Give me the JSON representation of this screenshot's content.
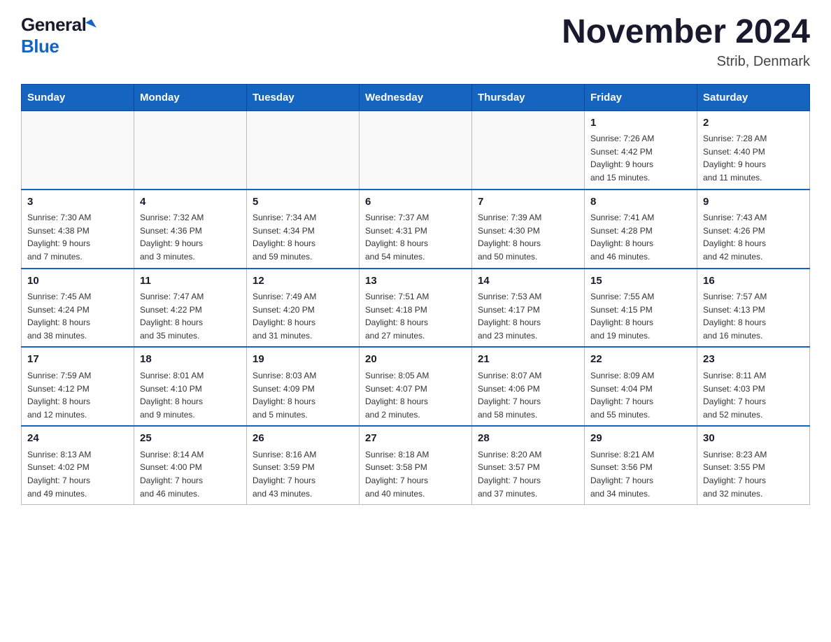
{
  "logo": {
    "general": "General",
    "blue": "Blue"
  },
  "title": "November 2024",
  "location": "Strib, Denmark",
  "days_of_week": [
    "Sunday",
    "Monday",
    "Tuesday",
    "Wednesday",
    "Thursday",
    "Friday",
    "Saturday"
  ],
  "weeks": [
    [
      {
        "day": "",
        "info": ""
      },
      {
        "day": "",
        "info": ""
      },
      {
        "day": "",
        "info": ""
      },
      {
        "day": "",
        "info": ""
      },
      {
        "day": "",
        "info": ""
      },
      {
        "day": "1",
        "info": "Sunrise: 7:26 AM\nSunset: 4:42 PM\nDaylight: 9 hours\nand 15 minutes."
      },
      {
        "day": "2",
        "info": "Sunrise: 7:28 AM\nSunset: 4:40 PM\nDaylight: 9 hours\nand 11 minutes."
      }
    ],
    [
      {
        "day": "3",
        "info": "Sunrise: 7:30 AM\nSunset: 4:38 PM\nDaylight: 9 hours\nand 7 minutes."
      },
      {
        "day": "4",
        "info": "Sunrise: 7:32 AM\nSunset: 4:36 PM\nDaylight: 9 hours\nand 3 minutes."
      },
      {
        "day": "5",
        "info": "Sunrise: 7:34 AM\nSunset: 4:34 PM\nDaylight: 8 hours\nand 59 minutes."
      },
      {
        "day": "6",
        "info": "Sunrise: 7:37 AM\nSunset: 4:31 PM\nDaylight: 8 hours\nand 54 minutes."
      },
      {
        "day": "7",
        "info": "Sunrise: 7:39 AM\nSunset: 4:30 PM\nDaylight: 8 hours\nand 50 minutes."
      },
      {
        "day": "8",
        "info": "Sunrise: 7:41 AM\nSunset: 4:28 PM\nDaylight: 8 hours\nand 46 minutes."
      },
      {
        "day": "9",
        "info": "Sunrise: 7:43 AM\nSunset: 4:26 PM\nDaylight: 8 hours\nand 42 minutes."
      }
    ],
    [
      {
        "day": "10",
        "info": "Sunrise: 7:45 AM\nSunset: 4:24 PM\nDaylight: 8 hours\nand 38 minutes."
      },
      {
        "day": "11",
        "info": "Sunrise: 7:47 AM\nSunset: 4:22 PM\nDaylight: 8 hours\nand 35 minutes."
      },
      {
        "day": "12",
        "info": "Sunrise: 7:49 AM\nSunset: 4:20 PM\nDaylight: 8 hours\nand 31 minutes."
      },
      {
        "day": "13",
        "info": "Sunrise: 7:51 AM\nSunset: 4:18 PM\nDaylight: 8 hours\nand 27 minutes."
      },
      {
        "day": "14",
        "info": "Sunrise: 7:53 AM\nSunset: 4:17 PM\nDaylight: 8 hours\nand 23 minutes."
      },
      {
        "day": "15",
        "info": "Sunrise: 7:55 AM\nSunset: 4:15 PM\nDaylight: 8 hours\nand 19 minutes."
      },
      {
        "day": "16",
        "info": "Sunrise: 7:57 AM\nSunset: 4:13 PM\nDaylight: 8 hours\nand 16 minutes."
      }
    ],
    [
      {
        "day": "17",
        "info": "Sunrise: 7:59 AM\nSunset: 4:12 PM\nDaylight: 8 hours\nand 12 minutes."
      },
      {
        "day": "18",
        "info": "Sunrise: 8:01 AM\nSunset: 4:10 PM\nDaylight: 8 hours\nand 9 minutes."
      },
      {
        "day": "19",
        "info": "Sunrise: 8:03 AM\nSunset: 4:09 PM\nDaylight: 8 hours\nand 5 minutes."
      },
      {
        "day": "20",
        "info": "Sunrise: 8:05 AM\nSunset: 4:07 PM\nDaylight: 8 hours\nand 2 minutes."
      },
      {
        "day": "21",
        "info": "Sunrise: 8:07 AM\nSunset: 4:06 PM\nDaylight: 7 hours\nand 58 minutes."
      },
      {
        "day": "22",
        "info": "Sunrise: 8:09 AM\nSunset: 4:04 PM\nDaylight: 7 hours\nand 55 minutes."
      },
      {
        "day": "23",
        "info": "Sunrise: 8:11 AM\nSunset: 4:03 PM\nDaylight: 7 hours\nand 52 minutes."
      }
    ],
    [
      {
        "day": "24",
        "info": "Sunrise: 8:13 AM\nSunset: 4:02 PM\nDaylight: 7 hours\nand 49 minutes."
      },
      {
        "day": "25",
        "info": "Sunrise: 8:14 AM\nSunset: 4:00 PM\nDaylight: 7 hours\nand 46 minutes."
      },
      {
        "day": "26",
        "info": "Sunrise: 8:16 AM\nSunset: 3:59 PM\nDaylight: 7 hours\nand 43 minutes."
      },
      {
        "day": "27",
        "info": "Sunrise: 8:18 AM\nSunset: 3:58 PM\nDaylight: 7 hours\nand 40 minutes."
      },
      {
        "day": "28",
        "info": "Sunrise: 8:20 AM\nSunset: 3:57 PM\nDaylight: 7 hours\nand 37 minutes."
      },
      {
        "day": "29",
        "info": "Sunrise: 8:21 AM\nSunset: 3:56 PM\nDaylight: 7 hours\nand 34 minutes."
      },
      {
        "day": "30",
        "info": "Sunrise: 8:23 AM\nSunset: 3:55 PM\nDaylight: 7 hours\nand 32 minutes."
      }
    ]
  ]
}
